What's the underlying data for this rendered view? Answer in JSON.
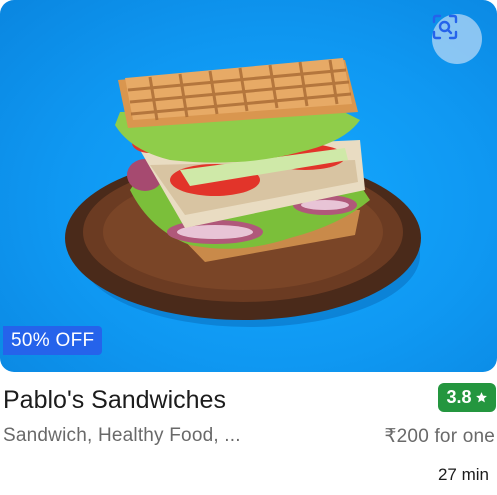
{
  "restaurant": {
    "name": "Pablo's Sandwiches",
    "rating": "3.8",
    "cuisines": "Sandwich, Healthy Food, ...",
    "price": "₹200 for one",
    "delivery_time": "27 min",
    "offer": "50% OFF"
  },
  "icons": {
    "scan": "scan-icon",
    "star": "star-icon",
    "image": "sandwich-photo"
  },
  "colors": {
    "offer_badge": "#2563eb",
    "rating_badge": "#24963f",
    "image_background": "#0f98f2"
  }
}
